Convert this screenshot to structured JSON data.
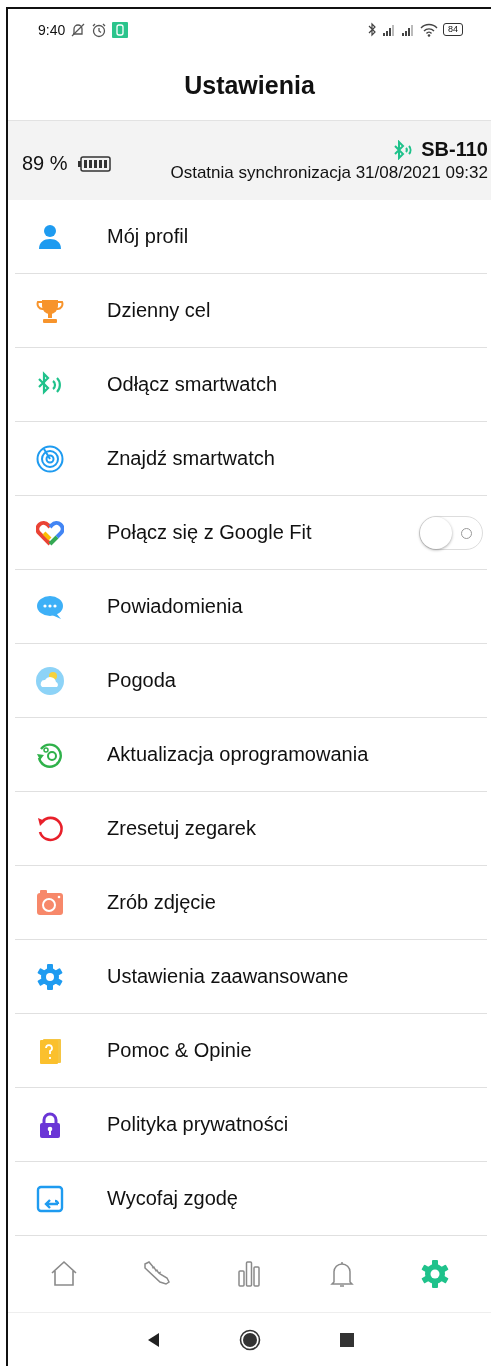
{
  "status_bar": {
    "time": "9:40",
    "battery": "84"
  },
  "header": {
    "title": "Ustawienia"
  },
  "device": {
    "battery": "89 %",
    "name": "SB-110",
    "last_sync": "Ostatnia synchronizacja 31/08/2021 09:32"
  },
  "items": [
    {
      "kind": "link",
      "label": "Mój profil"
    },
    {
      "kind": "link",
      "label": "Dzienny cel"
    },
    {
      "kind": "link",
      "label": "Odłącz smartwatch"
    },
    {
      "kind": "link",
      "label": "Znajdź smartwatch"
    },
    {
      "kind": "toggle",
      "label": "Połącz się z Google Fit",
      "on": false
    },
    {
      "kind": "link",
      "label": "Powiadomienia"
    },
    {
      "kind": "link",
      "label": "Pogoda"
    },
    {
      "kind": "link",
      "label": "Aktualizacja oprogramowania"
    },
    {
      "kind": "link",
      "label": "Zresetuj zegarek"
    },
    {
      "kind": "link",
      "label": "Zrób zdjęcie"
    },
    {
      "kind": "link",
      "label": "Ustawienia zaawansowane"
    },
    {
      "kind": "link",
      "label": "Pomoc & Opinie"
    },
    {
      "kind": "link",
      "label": "Polityka prywatności"
    },
    {
      "kind": "link",
      "label": "Wycofaj zgodę"
    }
  ],
  "bottom_nav": [
    {
      "selected": false
    },
    {
      "selected": false
    },
    {
      "selected": false
    },
    {
      "selected": false
    },
    {
      "selected": true
    }
  ]
}
